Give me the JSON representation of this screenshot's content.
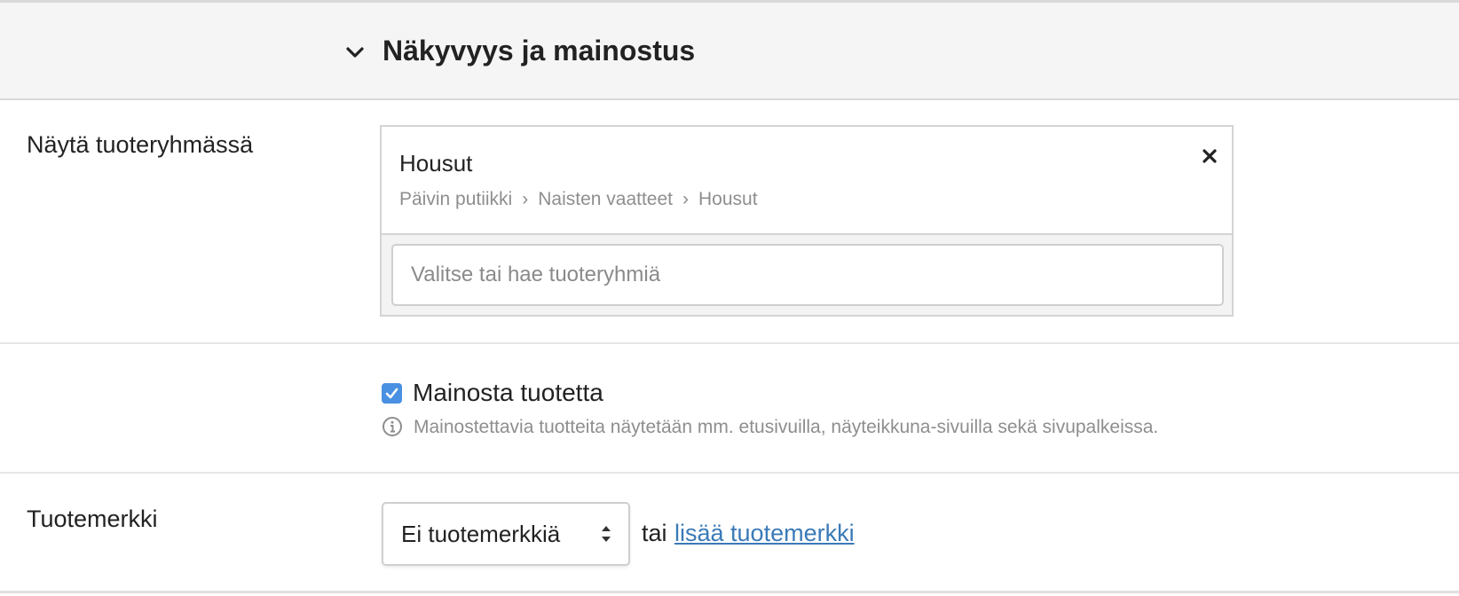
{
  "section": {
    "title": "Näkyvyys ja mainostus",
    "chevron_icon": "chevron-down-icon"
  },
  "product_group": {
    "label": "Näytä tuoteryhmässä",
    "selected": {
      "name": "Housut",
      "breadcrumb": [
        "Päivin putiikki",
        "Naisten vaatteet",
        "Housut"
      ],
      "separator": "›",
      "remove_icon": "close-icon"
    },
    "search": {
      "placeholder": "Valitse tai hae tuoteryhmiä",
      "value": ""
    }
  },
  "promote": {
    "checkbox_label": "Mainosta tuotetta",
    "checked": true,
    "help_text": "Mainostettavia tuotteita näytetään mm. etusivuilla, näyteikkuna-sivuilla sekä sivupalkeissa.",
    "help_icon": "info-icon"
  },
  "brand": {
    "label": "Tuotemerkki",
    "select_value": "Ei tuotemerkkiä",
    "or_text": "tai",
    "add_link": "lisää tuotemerkki"
  },
  "colors": {
    "header_bg": "#f5f5f5",
    "checkbox": "#4a90e2",
    "link": "#3a7ab8",
    "muted_text": "#8e8e8e"
  }
}
